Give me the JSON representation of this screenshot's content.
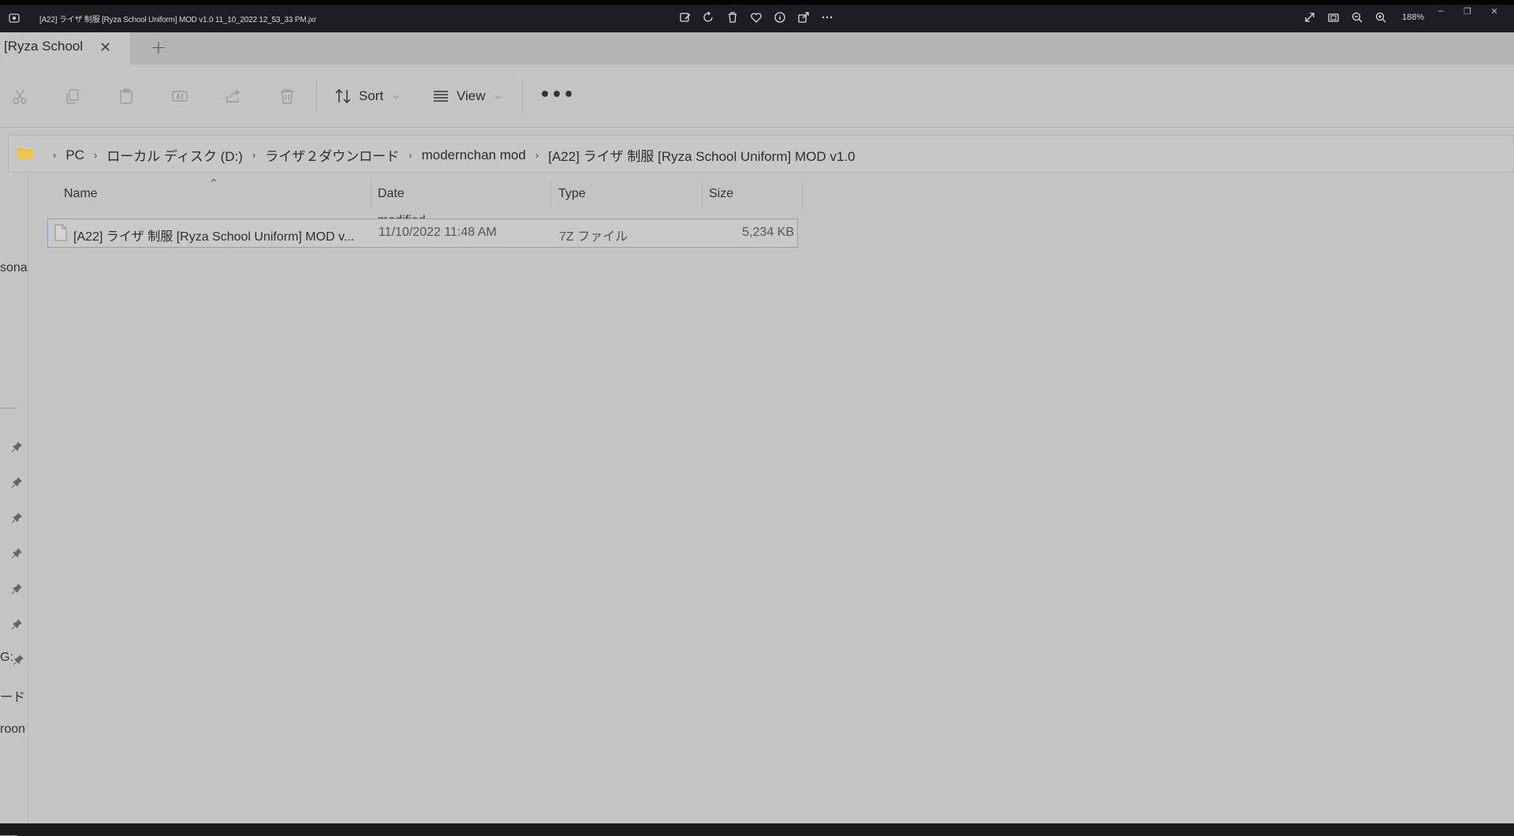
{
  "viewer": {
    "title": "[A22] ライザ 制服 [Ryza School Uniform] MOD v1.0 11_10_2022 12_53_33 PM.jxr",
    "zoom": "188%",
    "tools": [
      "edit-icon",
      "rotate-icon",
      "delete-icon",
      "favorite-icon",
      "info-icon",
      "share-icon",
      "more-icon"
    ],
    "right_tools": [
      "fullscreen-icon",
      "fit-icon",
      "zoom-out-icon",
      "zoom-in-icon"
    ]
  },
  "tab": {
    "label": "[Ryza School",
    "close": "✕",
    "new": "+"
  },
  "toolbar": {
    "sort_label": "Sort",
    "view_label": "View",
    "more": "•••"
  },
  "address": {
    "crumbs": [
      "PC",
      "ローカル ディスク (D:)",
      "ライザ２ダウンロード",
      "modernchan mod",
      "[A22] ライザ 制服 [Ryza School Uniform] MOD v1.0"
    ]
  },
  "nav": {
    "partial_labels": [
      "sona",
      "G:",
      "ード",
      "roon"
    ]
  },
  "columns": {
    "name": "Name",
    "date": "Date modified",
    "type": "Type",
    "size": "Size"
  },
  "files": [
    {
      "name": "[A22] ライザ 制服 [Ryza School Uniform] MOD v...",
      "date": "11/10/2022 11:48 AM",
      "type": "7Z ファイル",
      "size": "5,234 KB"
    }
  ],
  "colors": {
    "explorer_bg": "#c4c4c4",
    "selection_border": "#7fa4cf",
    "folder": "#e8b93a"
  }
}
